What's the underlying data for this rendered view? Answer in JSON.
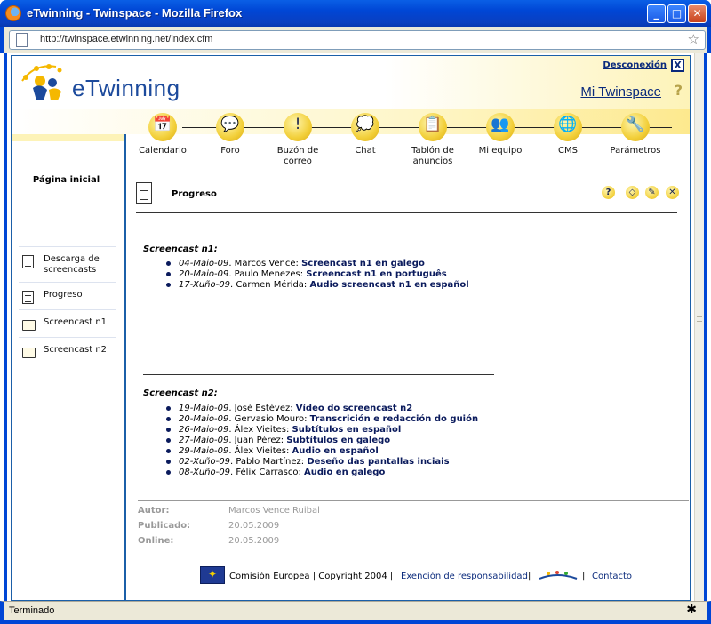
{
  "window": {
    "title": "eTwinning - Twinspace - Mozilla Firefox",
    "url": "http://twinspace.etwinning.net/index.cfm",
    "status": "Terminado",
    "buttons": {
      "minimize": "_",
      "maximize": "□",
      "close": "✕"
    }
  },
  "header": {
    "logo_text": "eTwinning",
    "logout": "Desconexión",
    "logout_close": "X",
    "twinspace": "Mi Twinspace",
    "help": "?"
  },
  "nav": [
    {
      "label": "Calendario",
      "icon": "calendar-icon",
      "glyph": "📅"
    },
    {
      "label": "Foro",
      "icon": "forum-icon",
      "glyph": "💬"
    },
    {
      "label": "Buzón de correo",
      "icon": "mailbox-icon",
      "glyph": "!"
    },
    {
      "label": "Chat",
      "icon": "chat-icon",
      "glyph": "💭"
    },
    {
      "label": "Tablón de anuncios",
      "icon": "noticeboard-icon",
      "glyph": "📋"
    },
    {
      "label": "Mi equipo",
      "icon": "team-icon",
      "glyph": "👥"
    },
    {
      "label": "CMS",
      "icon": "cms-icon",
      "glyph": "🌐"
    },
    {
      "label": "Parámetros",
      "icon": "tools-icon",
      "glyph": "🔧"
    }
  ],
  "sidebar": {
    "title": "Página inicial",
    "items": [
      {
        "label": "Descarga de screencasts",
        "icon": "document-icon"
      },
      {
        "label": "Progreso",
        "icon": "document-icon"
      },
      {
        "label": "Screencast n1",
        "icon": "folder-icon"
      },
      {
        "label": "Screencast n2",
        "icon": "folder-icon"
      }
    ]
  },
  "content": {
    "title": "Progreso",
    "tools": {
      "help": "?",
      "edit": "◇",
      "rename": "✎",
      "delete": "✕"
    },
    "section1": {
      "heading": "Screencast n1:",
      "items": [
        {
          "date": "04-Maio-09",
          "person": ". Marcos Vence: ",
          "title": "Screencast n1 en galego"
        },
        {
          "date": "20-Maio-09",
          "person": ". Paulo Menezes: ",
          "title": "Screencast n1 en português"
        },
        {
          "date": "17-Xuño-09",
          "person": ". Carmen Mérida: ",
          "title": "Audio screencast n1 en español"
        }
      ]
    },
    "section2": {
      "heading": "Screencast n2:",
      "items": [
        {
          "date": "19-Maio-09",
          "person": ". José Estévez: ",
          "title": "Vídeo do screencast n2"
        },
        {
          "date": "20-Maio-09",
          "person": ". Gervasio Mouro: ",
          "title": "Transcrición e redacción do guión"
        },
        {
          "date": "26-Maio-09",
          "person": ". Álex Vieites: ",
          "title": "Subtítulos en español"
        },
        {
          "date": "27-Maio-09",
          "person": ". Juan Pérez: ",
          "title": "Subtítulos en galego"
        },
        {
          "date": "29-Maio-09",
          "person": ". Álex Vieites: ",
          "title": "Audio en español"
        },
        {
          "date": "02-Xuño-09",
          "person": ". Pablo Martínez: ",
          "title": "Deseño das pantallas inciais"
        },
        {
          "date": "08-Xuño-09",
          "person": ". Félix Carrasco: ",
          "title": "Audio en galego"
        }
      ]
    },
    "meta": {
      "author_label": "Autor:",
      "author": "Marcos Vence Ruibal",
      "published_label": "Publicado:",
      "published": "20.05.2009",
      "online_label": "Online:",
      "online": "20.05.2009"
    }
  },
  "footer": {
    "text": "Comisión Europea | Copyright 2004 | ",
    "disclaimer": "Exención de responsabilidad",
    "sep1": " |",
    "sep2": "| ",
    "contact": "Contacto"
  }
}
